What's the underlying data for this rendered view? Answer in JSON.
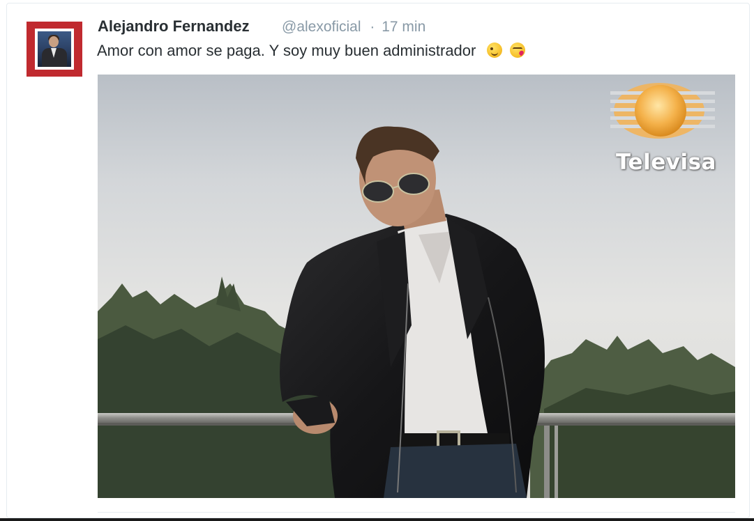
{
  "tweet": {
    "author_name": "Alejandro Fernandez",
    "handle": "@alexoficial",
    "separator": "·",
    "time": "17 min",
    "text": "Amor con amor se paga. Y soy muy buen administrador",
    "emojis": [
      "winking-face-icon",
      "face-blowing-kiss-icon"
    ]
  },
  "media": {
    "watermark": "Televisa"
  },
  "colors": {
    "avatar_border": "#c02a2f",
    "name": "#292f33",
    "meta": "#8899a6"
  }
}
